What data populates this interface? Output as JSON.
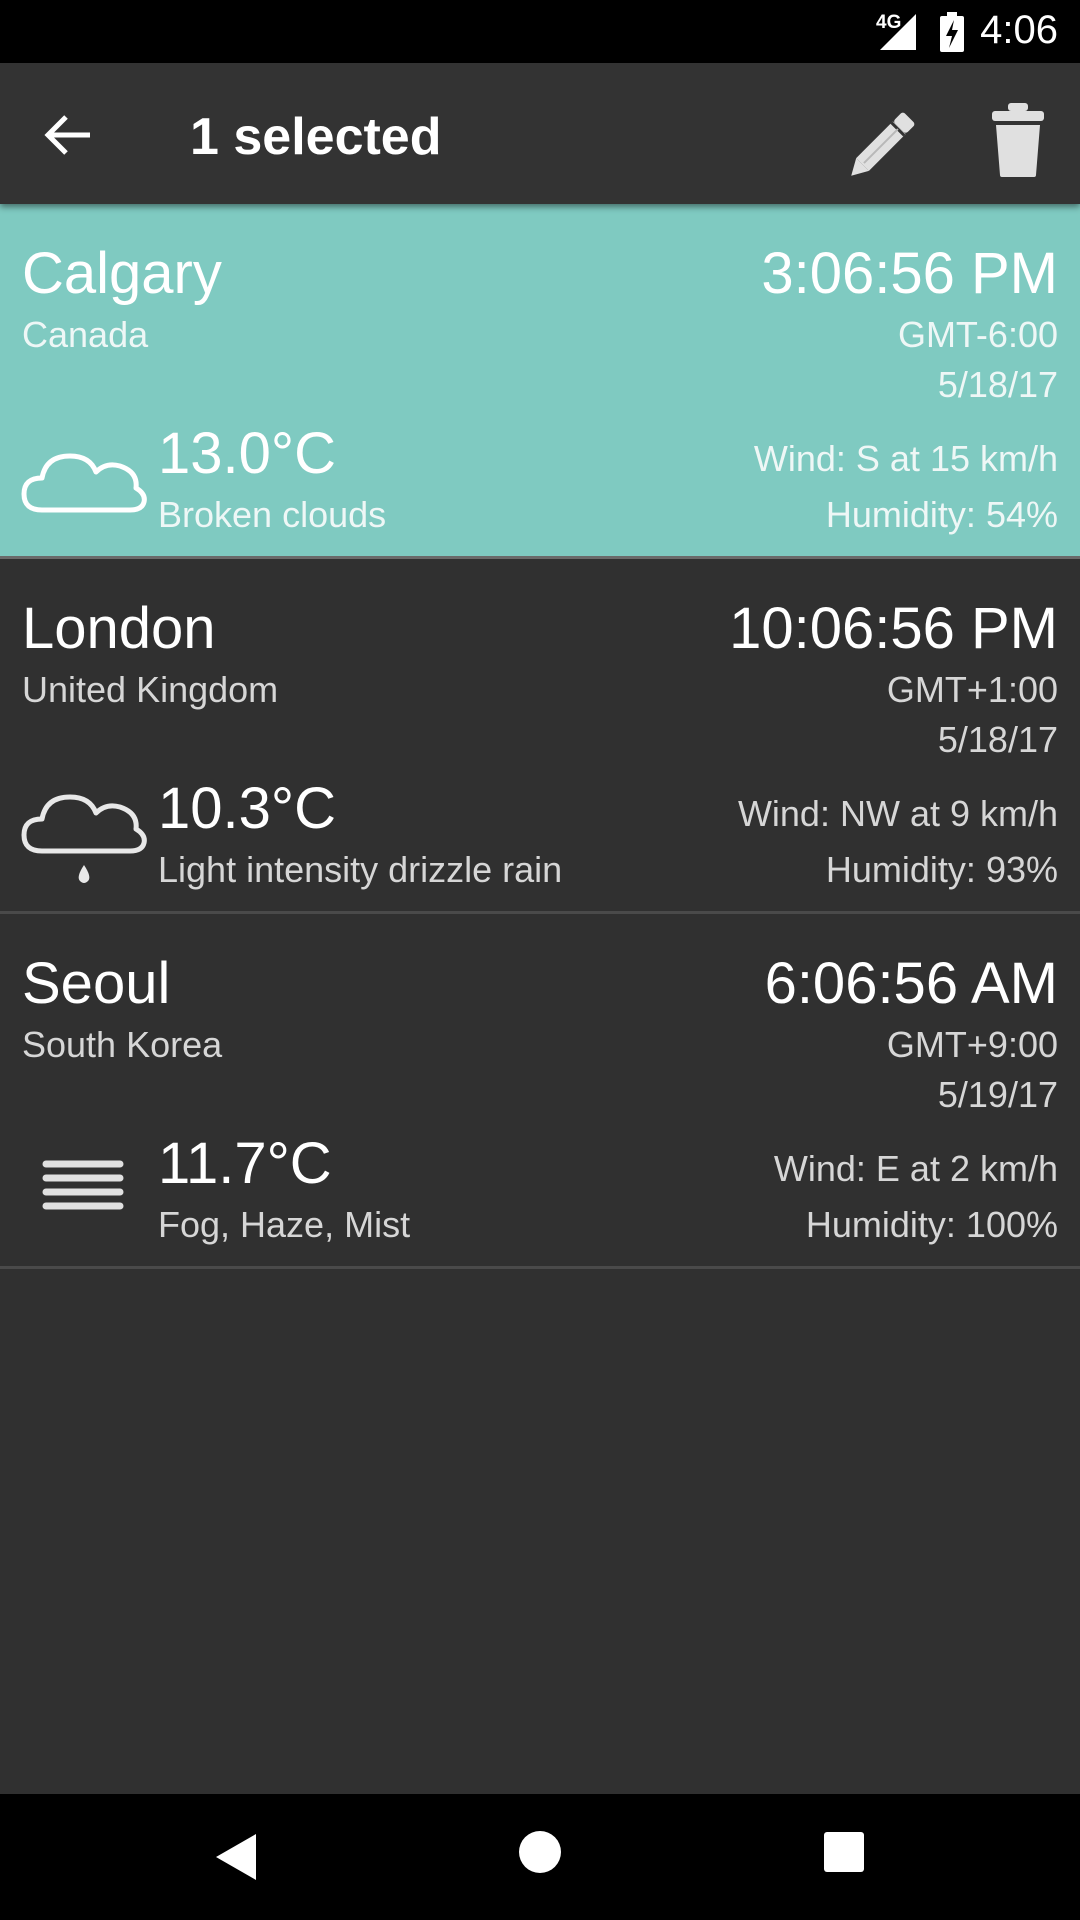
{
  "status_bar": {
    "network_label": "4G",
    "clock": "4:06",
    "icons": [
      "signal-icon",
      "battery-charging-icon"
    ]
  },
  "app_bar": {
    "title": "1 selected",
    "icons": [
      "back-arrow-icon",
      "pencil-icon",
      "trash-icon"
    ]
  },
  "accent_color": "#7fcac1",
  "cities": [
    {
      "name": "Calgary",
      "country": "Canada",
      "time": "3:06:56 PM",
      "gmt": "GMT-6:00",
      "date": "5/18/17",
      "temperature": "13.0°C",
      "condition": "Broken clouds",
      "wind": "Wind: S at 15 km/h",
      "humidity": "Humidity: 54%",
      "icon": "cloud-icon",
      "selected": true
    },
    {
      "name": "London",
      "country": "United Kingdom",
      "time": "10:06:56 PM",
      "gmt": "GMT+1:00",
      "date": "5/18/17",
      "temperature": "10.3°C",
      "condition": "Light intensity drizzle rain",
      "wind": "Wind: NW at 9 km/h",
      "humidity": "Humidity: 93%",
      "icon": "drizzle-icon",
      "selected": false
    },
    {
      "name": "Seoul",
      "country": "South Korea",
      "time": "6:06:56 AM",
      "gmt": "GMT+9:00",
      "date": "5/19/17",
      "temperature": "11.7°C",
      "condition": "Fog, Haze, Mist",
      "wind": "Wind: E at 2 km/h",
      "humidity": "Humidity: 100%",
      "icon": "fog-icon",
      "selected": false
    }
  ],
  "nav_bar": {
    "icons": [
      "nav-back-icon",
      "nav-home-icon",
      "nav-recents-icon"
    ]
  }
}
